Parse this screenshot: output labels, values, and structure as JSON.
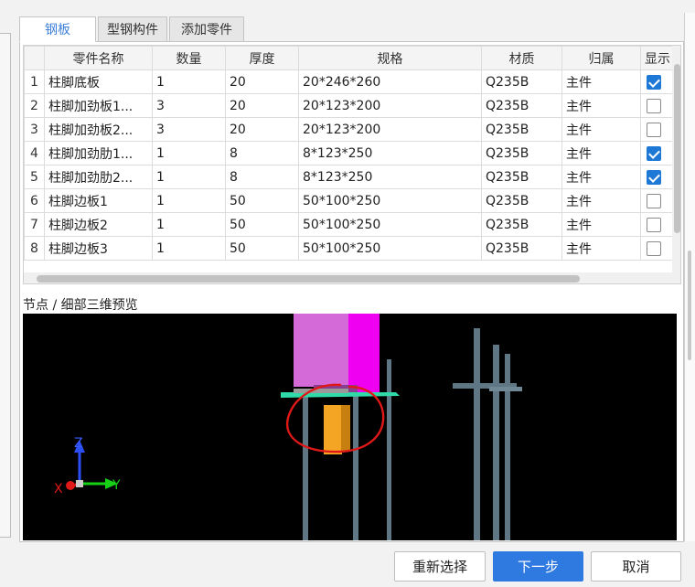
{
  "tabs": [
    {
      "label": "钢板",
      "active": true
    },
    {
      "label": "型钢构件",
      "active": false
    },
    {
      "label": "添加零件",
      "active": false
    }
  ],
  "table": {
    "columns": [
      "",
      "零件名称",
      "数量",
      "厚度",
      "规格",
      "材质",
      "归属",
      "显示"
    ],
    "rows": [
      {
        "no": "1",
        "name": "柱脚底板",
        "qty": "1",
        "thick": "20",
        "spec": "20*246*260",
        "mat": "Q235B",
        "owner": "主件",
        "show": true
      },
      {
        "no": "2",
        "name": "柱脚加劲板1...",
        "qty": "3",
        "thick": "20",
        "spec": "20*123*200",
        "mat": "Q235B",
        "owner": "主件",
        "show": false
      },
      {
        "no": "3",
        "name": "柱脚加劲板2...",
        "qty": "3",
        "thick": "20",
        "spec": "20*123*200",
        "mat": "Q235B",
        "owner": "主件",
        "show": false
      },
      {
        "no": "4",
        "name": "柱脚加劲肋1...",
        "qty": "1",
        "thick": "8",
        "spec": "8*123*250",
        "mat": "Q235B",
        "owner": "主件",
        "show": true
      },
      {
        "no": "5",
        "name": "柱脚加劲肋2...",
        "qty": "1",
        "thick": "8",
        "spec": "8*123*250",
        "mat": "Q235B",
        "owner": "主件",
        "show": true
      },
      {
        "no": "6",
        "name": "柱脚边板1",
        "qty": "1",
        "thick": "50",
        "spec": "50*100*250",
        "mat": "Q235B",
        "owner": "主件",
        "show": false
      },
      {
        "no": "7",
        "name": "柱脚边板2",
        "qty": "1",
        "thick": "50",
        "spec": "50*100*250",
        "mat": "Q235B",
        "owner": "主件",
        "show": false
      },
      {
        "no": "8",
        "name": "柱脚边板3",
        "qty": "1",
        "thick": "50",
        "spec": "50*100*250",
        "mat": "Q235B",
        "owner": "主件",
        "show": false
      }
    ]
  },
  "preview": {
    "label": "节点 / 细部三维预览",
    "axis_x": "X",
    "axis_y": "Y",
    "axis_z": "Z",
    "colors": {
      "column": "#d46ad8",
      "column_side": "#f000f0",
      "base_plate": "#2fd9a8",
      "stiffener": "#f5a524",
      "rod": "#5f7685",
      "annotation": "#e01818"
    }
  },
  "buttons": {
    "reselect": "重新选择",
    "next": "下一步",
    "cancel": "取消"
  }
}
